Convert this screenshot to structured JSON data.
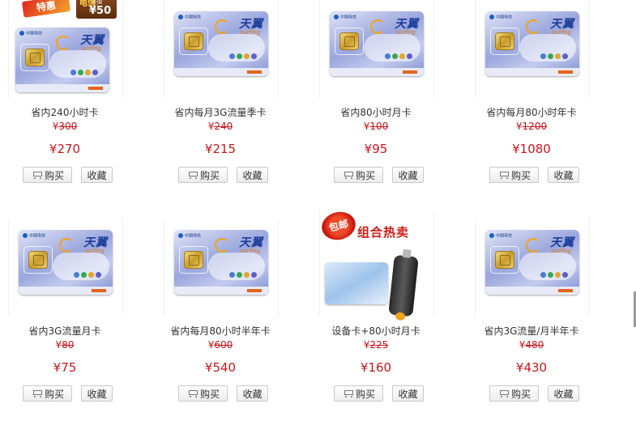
{
  "promo_badge": {
    "ribbon_text": "特惠",
    "tag_brand": "电信",
    "tag_sub": "全国",
    "tag_price": "¥50"
  },
  "common": {
    "currency": "¥",
    "buy_label": "购买",
    "fav_label": "收藏"
  },
  "card_art": {
    "brand": "天翼",
    "brand_sub": "surfing",
    "operator": "中国电信"
  },
  "combo_art": {
    "burst": "包邮",
    "title": "组合热卖"
  },
  "products": [
    {
      "name": "省内240小时卡",
      "old_price": "300",
      "price": "270"
    },
    {
      "name": "省内每月3G流量季卡",
      "old_price": "240",
      "price": "215"
    },
    {
      "name": "省内80小时月卡",
      "old_price": "100",
      "price": "95"
    },
    {
      "name": "省内每月80小时年卡",
      "old_price": "1200",
      "price": "1080"
    },
    {
      "name": "省内3G流量月卡",
      "old_price": "80",
      "price": "75"
    },
    {
      "name": "省内每月80小时半年卡",
      "old_price": "600",
      "price": "540"
    },
    {
      "name": "设备卡+80小时月卡",
      "old_price": "225",
      "price": "160"
    },
    {
      "name": "省内3G流量/月半年卡",
      "old_price": "480",
      "price": "430"
    }
  ]
}
